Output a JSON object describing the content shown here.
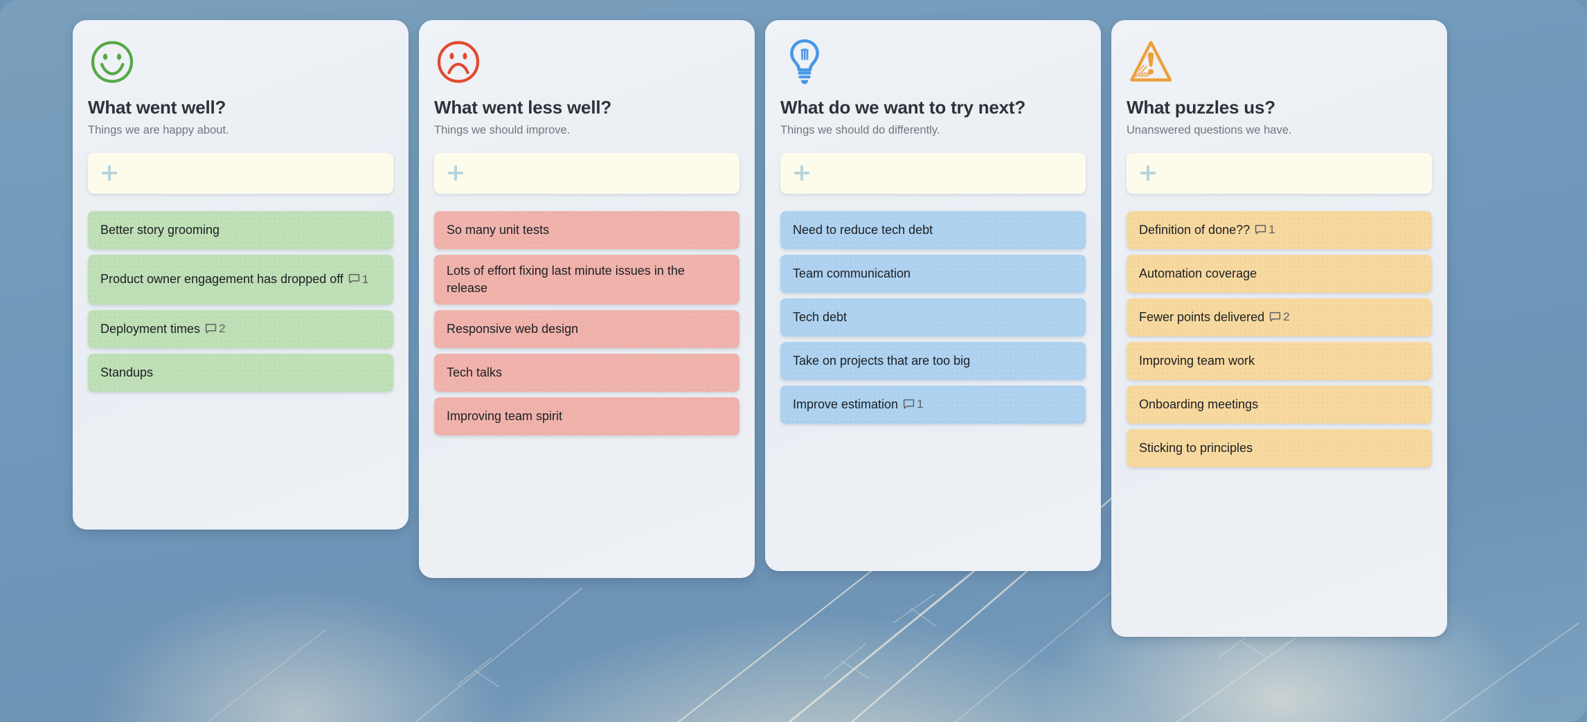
{
  "board": {
    "background_color": "#6f95b4",
    "panel_color": "#eef1f6",
    "add_card_color": "#fdfcec",
    "plus_icon": "plus-icon"
  },
  "columns": [
    {
      "id": "what-went-well",
      "icon": "smiley-face-icon",
      "icon_color": "#57a845",
      "title": "What went well?",
      "subtitle": "Things we are happy about.",
      "note_color": "#bfdfb6",
      "add_label": "+",
      "notes": [
        {
          "text": "Better story grooming",
          "comments": null
        },
        {
          "text": "Product owner engagement has dropped off",
          "comments": "1"
        },
        {
          "text": "Deployment times",
          "comments": "2"
        },
        {
          "text": "Standups",
          "comments": null
        }
      ]
    },
    {
      "id": "what-went-less-well",
      "icon": "sad-face-icon",
      "icon_color": "#e2482f",
      "title": "What went less well?",
      "subtitle": "Things we should improve.",
      "note_color": "#f0b3ac",
      "add_label": "+",
      "notes": [
        {
          "text": "So many unit tests",
          "comments": null
        },
        {
          "text": "Lots of effort fixing last minute issues in the release",
          "comments": null
        },
        {
          "text": "Responsive web design",
          "comments": null
        },
        {
          "text": "Tech talks",
          "comments": null
        },
        {
          "text": "Improving team spirit",
          "comments": null
        }
      ]
    },
    {
      "id": "what-do-we-want-to-try-next",
      "icon": "lightbulb-icon",
      "icon_color": "#4a97e8",
      "title": "What do we want to try next?",
      "subtitle": "Things we should do differently.",
      "note_color": "#aed2f0",
      "add_label": "+",
      "notes": [
        {
          "text": "Need to reduce tech debt",
          "comments": null
        },
        {
          "text": "Team communication",
          "comments": null
        },
        {
          "text": "Tech debt",
          "comments": null
        },
        {
          "text": "Take on projects that are too big",
          "comments": null
        },
        {
          "text": "Improve estimation",
          "comments": "1"
        }
      ]
    },
    {
      "id": "what-puzzles-us",
      "icon": "warning-triangle-icon",
      "icon_color": "#ee9f3a",
      "title": "What puzzles us?",
      "subtitle": "Unanswered questions we have.",
      "note_color": "#f7d89f",
      "add_label": "+",
      "notes": [
        {
          "text": "Definition of done??",
          "comments": "1"
        },
        {
          "text": "Automation coverage",
          "comments": null
        },
        {
          "text": "Fewer points delivered",
          "comments": "2"
        },
        {
          "text": "Improving team work",
          "comments": null
        },
        {
          "text": "Onboarding meetings",
          "comments": null
        },
        {
          "text": "Sticking to principles",
          "comments": null
        }
      ]
    }
  ]
}
